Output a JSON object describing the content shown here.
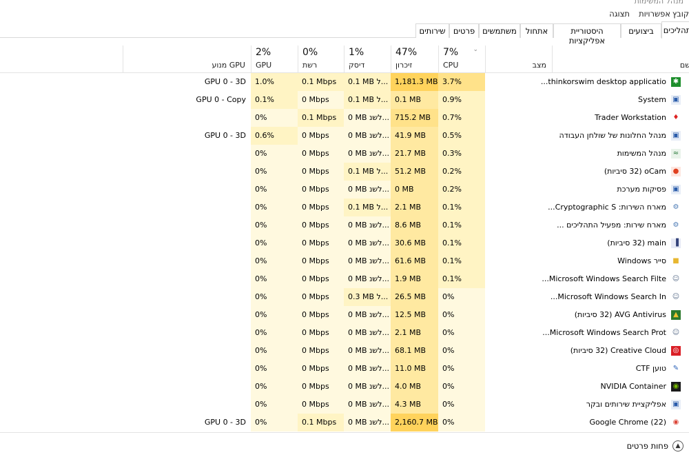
{
  "window": {
    "title": "מנהל המשימות"
  },
  "menu": [
    "קובץ",
    "אפשרויות",
    "תצוגה"
  ],
  "tabs": [
    "תהליכים",
    "ביצועים",
    "היסטוריית אפליקציות",
    "אתחול",
    "משתמשים",
    "פרטים",
    "שירותים"
  ],
  "columns": {
    "name": "שם",
    "status": "מצב",
    "cpu": {
      "pct": "7%",
      "label": "CPU"
    },
    "memory": {
      "pct": "47%",
      "label": "זיכרון"
    },
    "disk": {
      "pct": "1%",
      "label": "דיסק"
    },
    "network": {
      "pct": "0%",
      "label": "רשת"
    },
    "gpu": {
      "pct": "2%",
      "label": "GPU"
    },
    "gpu_engine": {
      "label": "מנוע GPU"
    }
  },
  "colors": {
    "cpu_default": "#fff4c4",
    "memory_default": "#ffe9a1",
    "disk_default": "#fff4c4",
    "network_default": "#fff4c4",
    "gpu_default": "#fff4c4",
    "strong": "#ffd35c",
    "medium": "#ffe28a",
    "light": "#fff9df"
  },
  "processes": [
    {
      "name": "thinkorswim desktop applicatio...",
      "icon": "thinkorswim-icon",
      "cpu": "3.7%",
      "memory": "1,181.3 MB",
      "disk": "0.1 MB ל...",
      "network": "0.1 Mbps",
      "gpu": "1.0%",
      "gpu_engine": "GPU 0 - 3D"
    },
    {
      "name": "System",
      "icon": "window-icon",
      "cpu": "0.9%",
      "memory": "0.1 MB",
      "disk": "0.1 MB ל...",
      "network": "0 Mbps",
      "gpu": "0.1%",
      "gpu_engine": "GPU 0 - Copy"
    },
    {
      "name": "Trader Workstation",
      "icon": "flame-icon",
      "cpu": "0.7%",
      "memory": "715.2 MB",
      "disk": "0 MB לשנ...",
      "network": "0.1 Mbps",
      "gpu": "0%",
      "gpu_engine": ""
    },
    {
      "name": "מנהל החלונות של שולחן העבודה",
      "icon": "window-icon",
      "cpu": "0.5%",
      "memory": "41.9 MB",
      "disk": "0 MB לשנ...",
      "network": "0 Mbps",
      "gpu": "0.6%",
      "gpu_engine": "GPU 0 - 3D"
    },
    {
      "name": "מנהל המשימות",
      "icon": "task-manager-icon",
      "cpu": "0.3%",
      "memory": "21.7 MB",
      "disk": "0 MB לשנ...",
      "network": "0 Mbps",
      "gpu": "0%",
      "gpu_engine": ""
    },
    {
      "name": "oCam (32 סיביות)",
      "icon": "ocam-icon",
      "cpu": "0.2%",
      "memory": "51.2 MB",
      "disk": "0.1 MB ל...",
      "network": "0 Mbps",
      "gpu": "0%",
      "gpu_engine": ""
    },
    {
      "name": "פסיקות מערכת",
      "icon": "window-icon",
      "cpu": "0.2%",
      "memory": "0 MB",
      "disk": "0 MB לשנ...",
      "network": "0 Mbps",
      "gpu": "0%",
      "gpu_engine": ""
    },
    {
      "name": "מארח השירות: Cryptographic S...",
      "icon": "gear-icon",
      "cpu": "0.1%",
      "memory": "2.1 MB",
      "disk": "0.1 MB ל...",
      "network": "0 Mbps",
      "gpu": "0%",
      "gpu_engine": ""
    },
    {
      "name": "מארח שירות: מפעיל התהליכים ...",
      "icon": "gear-icon",
      "cpu": "0.1%",
      "memory": "8.6 MB",
      "disk": "0 MB לשנ...",
      "network": "0 Mbps",
      "gpu": "0%",
      "gpu_engine": ""
    },
    {
      "name": "main (32 סיביות)",
      "icon": "bars-icon",
      "cpu": "0.1%",
      "memory": "30.6 MB",
      "disk": "0 MB לשנ...",
      "network": "0 Mbps",
      "gpu": "0%",
      "gpu_engine": ""
    },
    {
      "name": "סייר Windows",
      "icon": "folder-icon",
      "cpu": "0.1%",
      "memory": "61.6 MB",
      "disk": "0 MB לשנ...",
      "network": "0 Mbps",
      "gpu": "0%",
      "gpu_engine": ""
    },
    {
      "name": "Microsoft Windows Search Filte...",
      "icon": "search-user-icon",
      "cpu": "0.1%",
      "memory": "1.9 MB",
      "disk": "0 MB לשנ...",
      "network": "0 Mbps",
      "gpu": "0%",
      "gpu_engine": ""
    },
    {
      "name": "Microsoft Windows Search In...",
      "icon": "search-user-icon",
      "cpu": "0%",
      "memory": "26.5 MB",
      "disk": "0.3 MB ל...",
      "network": "0 Mbps",
      "gpu": "0%",
      "gpu_engine": ""
    },
    {
      "name": "AVG Antivirus (32 סיביות)",
      "icon": "avg-icon",
      "cpu": "0%",
      "memory": "12.5 MB",
      "disk": "0 MB לשנ...",
      "network": "0 Mbps",
      "gpu": "0%",
      "gpu_engine": ""
    },
    {
      "name": "Microsoft Windows Search Prot...",
      "icon": "search-user-icon",
      "cpu": "0%",
      "memory": "2.1 MB",
      "disk": "0 MB לשנ...",
      "network": "0 Mbps",
      "gpu": "0%",
      "gpu_engine": ""
    },
    {
      "name": "Creative Cloud (32 סיביות)",
      "icon": "creative-cloud-icon",
      "cpu": "0%",
      "memory": "68.1 MB",
      "disk": "0 MB לשנ...",
      "network": "0 Mbps",
      "gpu": "0%",
      "gpu_engine": ""
    },
    {
      "name": "טוען CTF",
      "icon": "notepad-icon",
      "cpu": "0%",
      "memory": "11.0 MB",
      "disk": "0 MB לשנ...",
      "network": "0 Mbps",
      "gpu": "0%",
      "gpu_engine": ""
    },
    {
      "name": "NVIDIA Container",
      "icon": "nvidia-icon",
      "cpu": "0%",
      "memory": "4.0 MB",
      "disk": "0 MB לשנ...",
      "network": "0 Mbps",
      "gpu": "0%",
      "gpu_engine": ""
    },
    {
      "name": "אפליקציית שירותים ובקר",
      "icon": "window-icon",
      "cpu": "0%",
      "memory": "4.3 MB",
      "disk": "0 MB לשנ...",
      "network": "0 Mbps",
      "gpu": "0%",
      "gpu_engine": ""
    },
    {
      "name": "Google Chrome (22)",
      "icon": "chrome-icon",
      "cpu": "0%",
      "memory": "2,160.7 MB",
      "disk": "0 MB לשנ...",
      "network": "0.1 Mbps",
      "gpu": "0%",
      "gpu_engine": "GPU 0 - 3D"
    }
  ],
  "footer": {
    "fewer_details": "פחות פרטים"
  }
}
